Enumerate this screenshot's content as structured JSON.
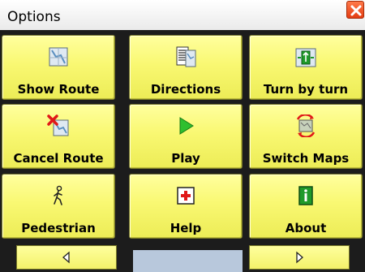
{
  "window": {
    "title": "Options"
  },
  "buttons": [
    {
      "label": "Show Route",
      "icon": "show-route-icon"
    },
    {
      "label": "Directions",
      "icon": "directions-icon"
    },
    {
      "label": "Turn by turn",
      "icon": "turn-by-turn-icon"
    },
    {
      "label": "Cancel Route",
      "icon": "cancel-route-icon"
    },
    {
      "label": "Play",
      "icon": "play-icon"
    },
    {
      "label": "Switch Maps",
      "icon": "switch-maps-icon"
    },
    {
      "label": "Pedestrian",
      "icon": "pedestrian-icon"
    },
    {
      "label": "Help",
      "icon": "help-icon"
    },
    {
      "label": "About",
      "icon": "about-icon"
    }
  ],
  "nav": {
    "prev_icon": "arrow-left-icon",
    "next_icon": "arrow-right-icon"
  },
  "colors": {
    "button_fill": "#f9f872",
    "close_button": "#e33c12",
    "play_green": "#2fbf2f",
    "help_red": "#e01818",
    "about_green": "#1f9a2a"
  }
}
